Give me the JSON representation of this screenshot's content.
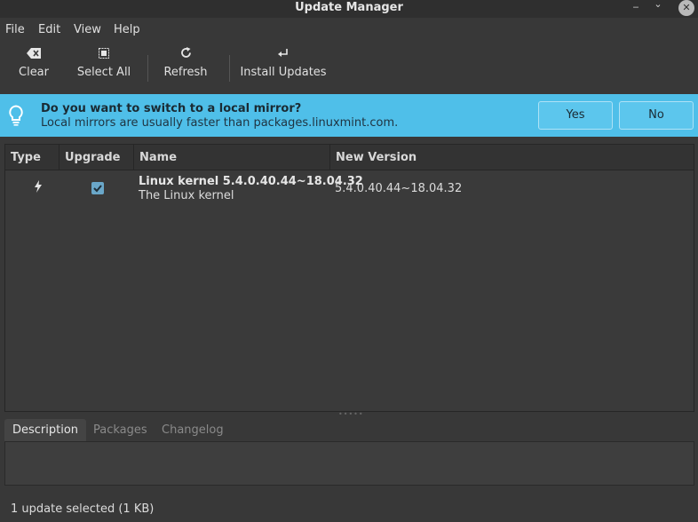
{
  "window": {
    "title": "Update Manager",
    "minimize_glyph": "‒",
    "maximize_glyph": "⌄",
    "close_glyph": "✕"
  },
  "menu": {
    "items": [
      "File",
      "Edit",
      "View",
      "Help"
    ]
  },
  "toolbar": {
    "clear_label": "Clear",
    "select_all_label": "Select All",
    "refresh_label": "Refresh",
    "install_label": "Install Updates"
  },
  "infobar": {
    "headline": "Do you want to switch to a local mirror?",
    "message": "Local mirrors are usually faster than packages.linuxmint.com.",
    "yes_label": "Yes",
    "no_label": "No",
    "color": "#4fbfe9"
  },
  "table": {
    "columns": [
      "Type",
      "Upgrade",
      "Name",
      "New Version"
    ],
    "rows": [
      {
        "type_icon": "kernel-bolt-icon",
        "upgrade": true,
        "name": "Linux kernel 5.4.0.40.44~18.04.32",
        "description": "The Linux kernel",
        "new_version": "5.4.0.40.44~18.04.32"
      }
    ]
  },
  "tabs": {
    "items": [
      "Description",
      "Packages",
      "Changelog"
    ],
    "active": "Description"
  },
  "status": {
    "text": "1 update selected (1 KB)"
  }
}
